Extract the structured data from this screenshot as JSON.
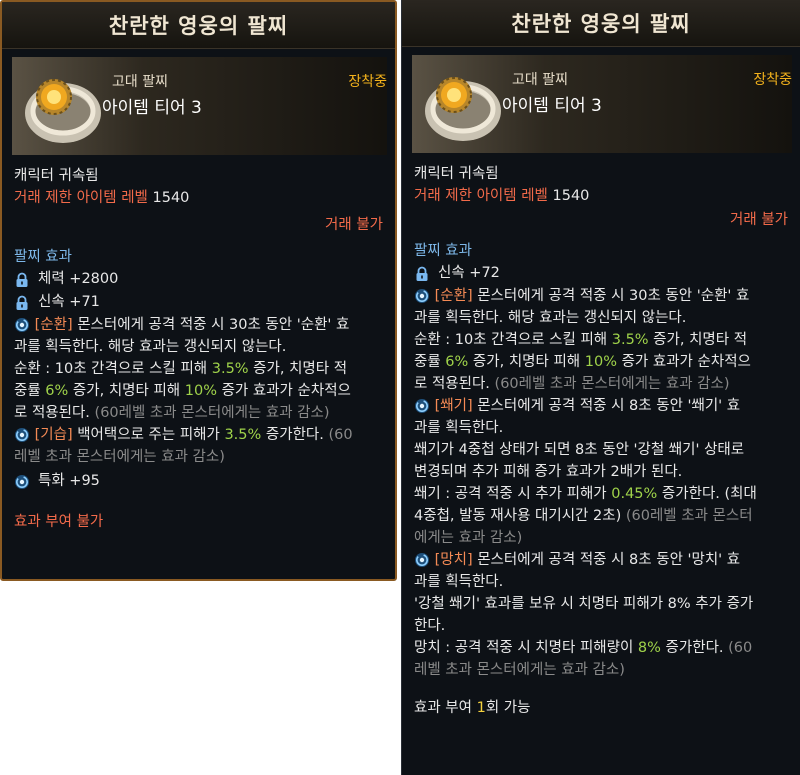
{
  "left": {
    "title": "찬란한 영웅의 팔찌",
    "category": "고대 팔찌",
    "tier": "아이템 티어 3",
    "equipped": "장착중",
    "bound": "캐릭터 귀속됨",
    "trade_level_label": "거래 제한 아이템 레벨",
    "trade_level_value": "1540",
    "trade_status": "거래 불가",
    "section_title": "팔찌 효과",
    "stats": [
      {
        "label": "체력 +2800",
        "icon": "lock-icon"
      },
      {
        "label": "신속 +71",
        "icon": "lock-icon"
      }
    ],
    "effect1": {
      "tag": "[순환]",
      "line1": " 몬스터에게 공격 적중 시 30초 동안 '순환' 효",
      "line2": "과를 획득한다. 해당 효과는 갱신되지 않는다.",
      "line3a": "순환 : 10초 간격으로 스킬 피해 ",
      "line3b": "3.5%",
      "line3c": " 증가, 치명타 적",
      "line4a": "중률 ",
      "line4b": "6%",
      "line4c": " 증가, 치명타 피해 ",
      "line4d": "10%",
      "line4e": " 증가 효과가 순차적으",
      "line5a": "로 적용된다. ",
      "line5b": "(60레벨 초과 몬스터에게는 효과 감소)"
    },
    "effect2": {
      "tag": "[기습]",
      "line1a": " 백어택으로 주는 피해가 ",
      "line1b": "3.5%",
      "line1c": " 증가한다. ",
      "line1d": "(60",
      "line2": "레벨 초과 몬스터에게는 효과 감소)"
    },
    "effect3": "특화 +95",
    "grant": "효과 부여 불가"
  },
  "right": {
    "title": "찬란한 영웅의 팔찌",
    "category": "고대 팔찌",
    "tier": "아이템 티어 3",
    "equipped": "장착중",
    "bound": "캐릭터 귀속됨",
    "trade_level_label": "거래 제한 아이템 레벨",
    "trade_level_value": "1540",
    "trade_status": "거래 불가",
    "section_title": "팔찌 효과",
    "stat": "신속 +72",
    "effect1": {
      "tag": "[순환]",
      "line1": " 몬스터에게 공격 적중 시 30초 동안 '순환' 효",
      "line2": "과를 획득한다. 해당 효과는 갱신되지 않는다.",
      "line3a": "순환 : 10초 간격으로 스킬 피해 ",
      "line3b": "3.5%",
      "line3c": " 증가, 치명타 적",
      "line4a": "중률 ",
      "line4b": "6%",
      "line4c": " 증가, 치명타 피해 ",
      "line4d": "10%",
      "line4e": " 증가 효과가 순차적으",
      "line5a": "로 적용된다. ",
      "line5b": "(60레벨 초과 몬스터에게는 효과 감소)"
    },
    "effect2": {
      "tag": "[쐐기]",
      "line1": " 몬스터에게 공격 적중 시 8초 동안 '쐐기' 효",
      "line2": "과를 획득한다.",
      "line3": "쐐기가 4중첩 상태가 되면 8초 동안 '강철 쐐기' 상태로",
      "line4": "변경되며 추가 피해 증가 효과가 2배가 된다.",
      "line5a": "쐐기 : 공격 적중 시 추가 피해가 ",
      "line5b": "0.45%",
      "line5c": " 증가한다. (최대",
      "line6a": "4중첩, 발동 재사용 대기시간 2초) ",
      "line6b": "(60레벨 초과 몬스터",
      "line7": "에게는 효과 감소)"
    },
    "effect3": {
      "tag": "[망치]",
      "line1": " 몬스터에게 공격 적중 시 8초 동안 '망치' 효",
      "line2": "과를 획득한다.",
      "line3": "'강철 쐐기' 효과를 보유 시 치명타 피해가 8% 추가 증가",
      "line4": "한다.",
      "line5a": "망치 : 공격 적중 시 치명타 피해량이 ",
      "line5b": "8%",
      "line5c": " 증가한다. ",
      "line5d": "(60",
      "line6": "레벨 초과 몬스터에게는 효과 감소)"
    },
    "grant_a": "효과 부여 ",
    "grant_b": "1",
    "grant_c": "회 가능"
  }
}
